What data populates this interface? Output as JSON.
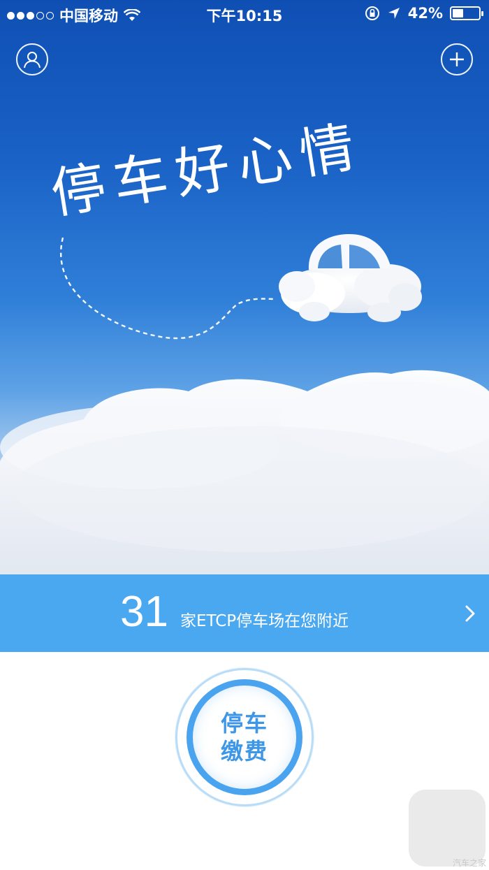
{
  "status_bar": {
    "signal_filled": 3,
    "signal_total": 5,
    "carrier": "中国移动",
    "wifi_icon": "wifi-icon",
    "time": "下午10:15",
    "lock_icon": "orientation-lock-icon",
    "location_icon": "location-arrow-icon",
    "battery_text": "42%",
    "battery_level": 0.42
  },
  "header": {
    "profile_icon": "user-profile-icon",
    "add_icon": "plus-icon"
  },
  "hero": {
    "slogan": "停车好心情",
    "illustration": "cloud-car-illustration"
  },
  "nearby": {
    "count": "31",
    "label": "家ETCP停车场在您附近",
    "chevron_icon": "chevron-right-icon"
  },
  "pay_button": {
    "line1": "停车",
    "line2": "缴费"
  },
  "assistive_touch": {
    "icon": "assistive-touch-icon"
  },
  "watermark": "汽车之家",
  "colors": {
    "banner": "#4aa8f0",
    "ring": "#4aa3ee",
    "pay_text": "#3d97e6",
    "sky_top": "#0f4fb4"
  }
}
